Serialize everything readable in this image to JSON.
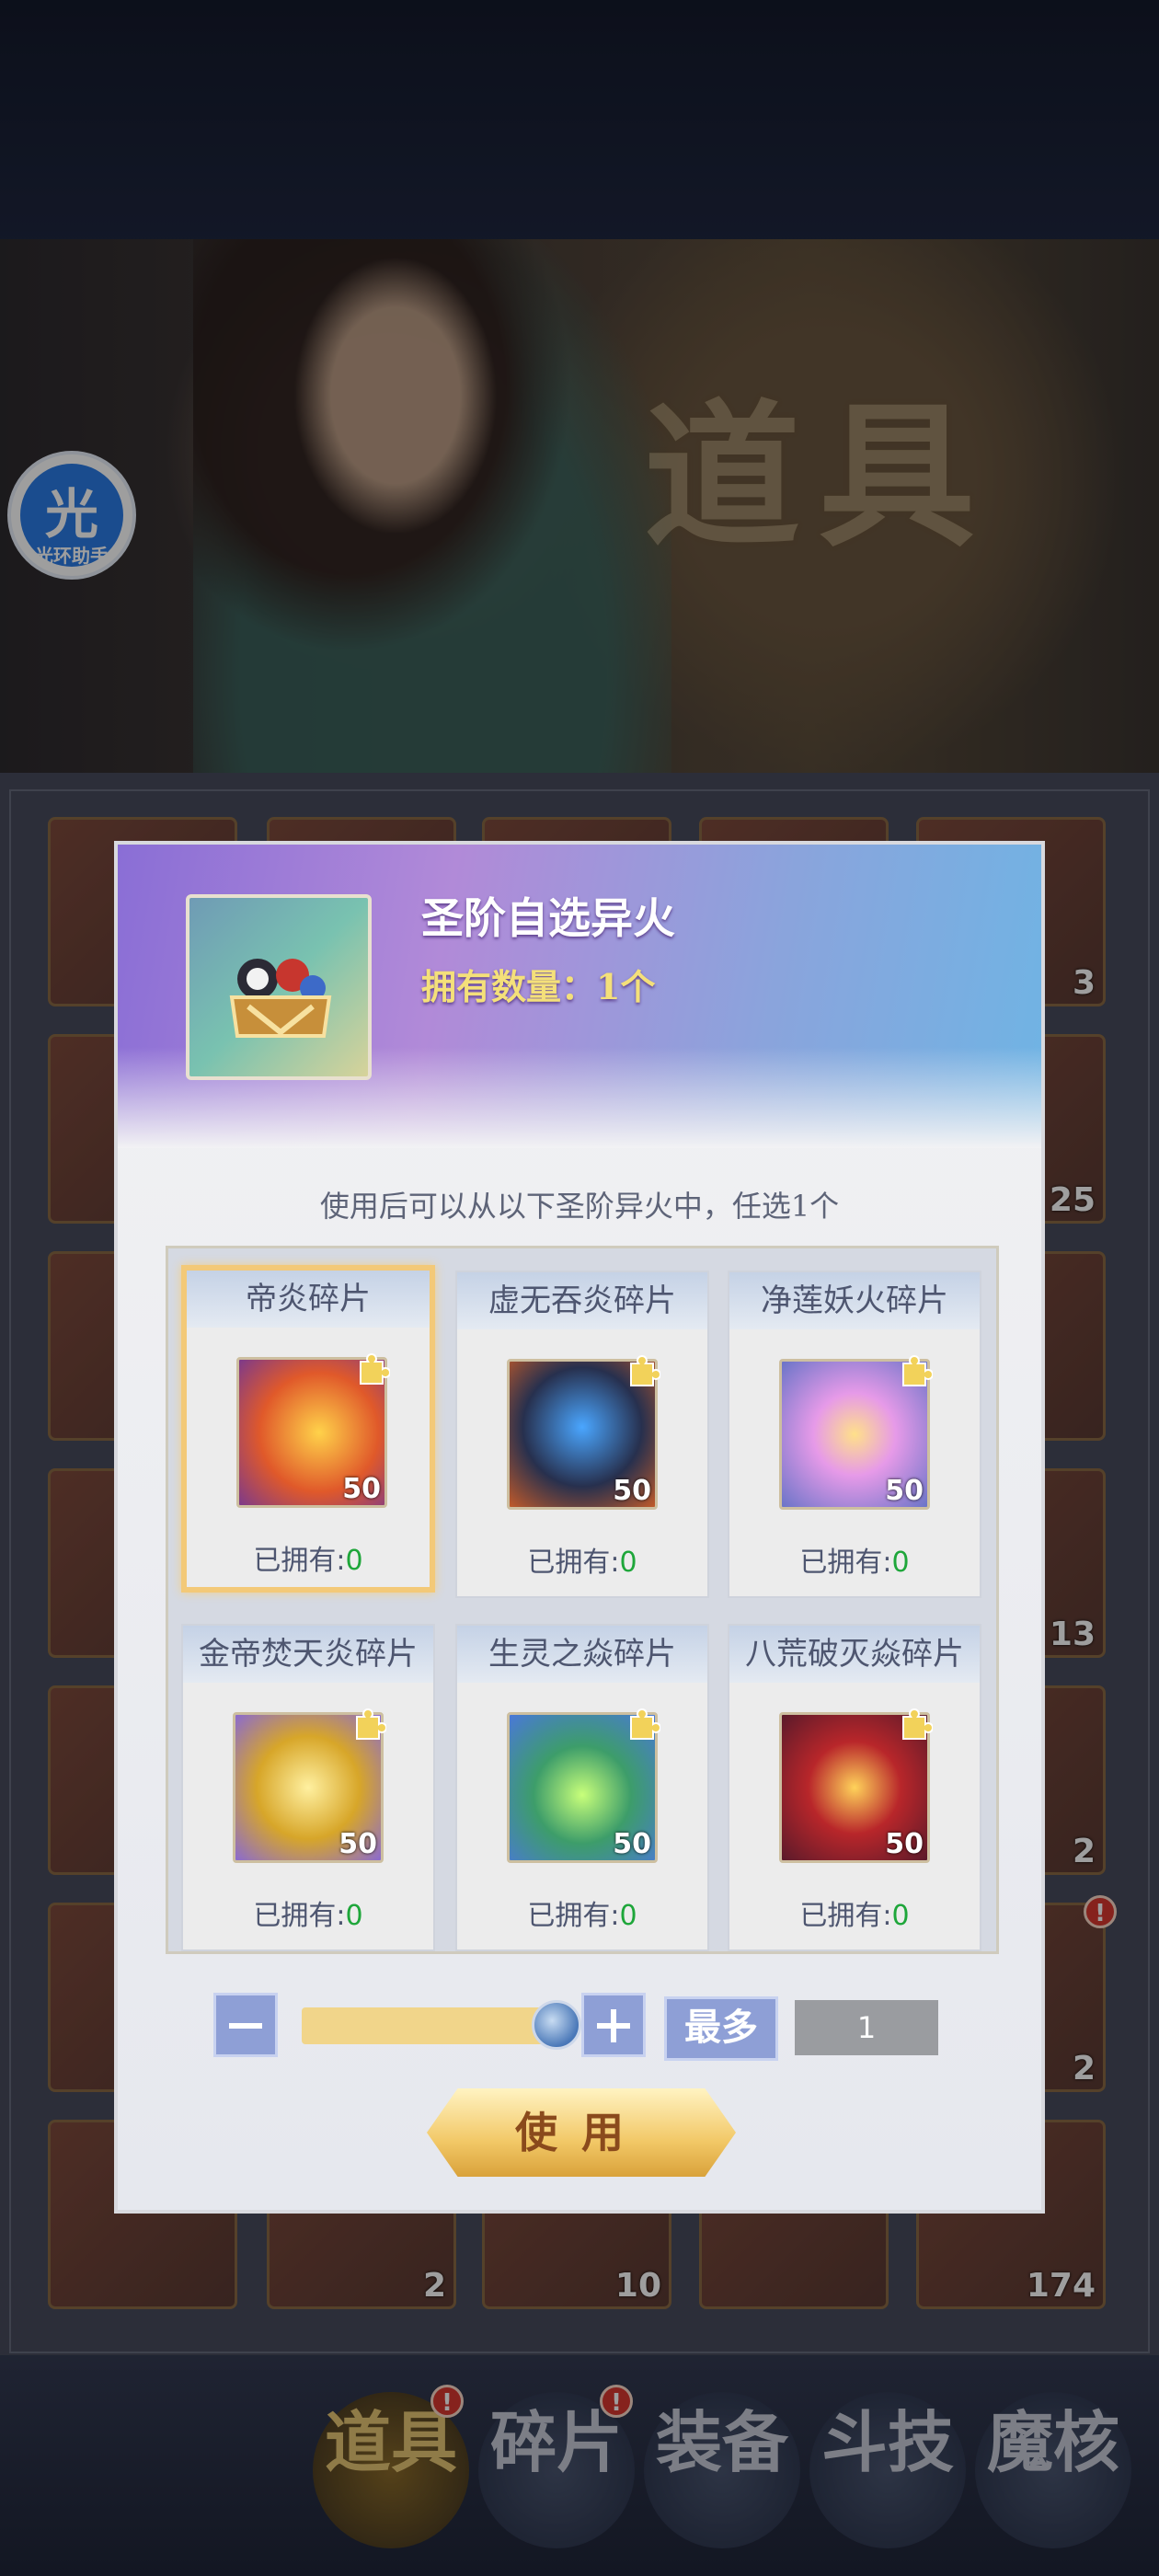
{
  "banner": {
    "title": "道具"
  },
  "assistant": {
    "glyph": "光",
    "label": "光环助手"
  },
  "background_counts": [
    "3",
    "25",
    "13",
    "2",
    "2",
    "2",
    "10",
    "174"
  ],
  "nav": {
    "items": [
      "道具",
      "碎片",
      "装备",
      "斗技",
      "魔核"
    ],
    "badge": "!"
  },
  "dialog": {
    "item_name": "圣阶自选异火",
    "owned_count": "拥有数量：1个",
    "description": "使用后可以从以下圣阶异火中，任选1个",
    "choices": [
      {
        "name": "帝炎碎片",
        "qty": "50",
        "owned_label": "已拥有:",
        "owned_value": "0",
        "color": "#e0592a"
      },
      {
        "name": "虚无吞炎碎片",
        "qty": "50",
        "owned_label": "已拥有:",
        "owned_value": "0",
        "color": "#27304e"
      },
      {
        "name": "净莲妖火碎片",
        "qty": "50",
        "owned_label": "已拥有:",
        "owned_value": "0",
        "color": "#c57ad8"
      },
      {
        "name": "金帝焚天炎碎片",
        "qty": "50",
        "owned_label": "已拥有:",
        "owned_value": "0",
        "color": "#d7a629"
      },
      {
        "name": "生灵之焱碎片",
        "qty": "50",
        "owned_label": "已拥有:",
        "owned_value": "0",
        "color": "#3d9d6a"
      },
      {
        "name": "八荒破灭焱碎片",
        "qty": "50",
        "owned_label": "已拥有:",
        "owned_value": "0",
        "color": "#b8262a"
      }
    ],
    "selected_index": 0,
    "stepper": {
      "max_label": "最多",
      "quantity": "1"
    },
    "use_label": "使用"
  },
  "colors": {
    "accent_gold": "#f3c978",
    "owned_green": "#1ea63a",
    "button_blue": "#8e9fd6"
  }
}
